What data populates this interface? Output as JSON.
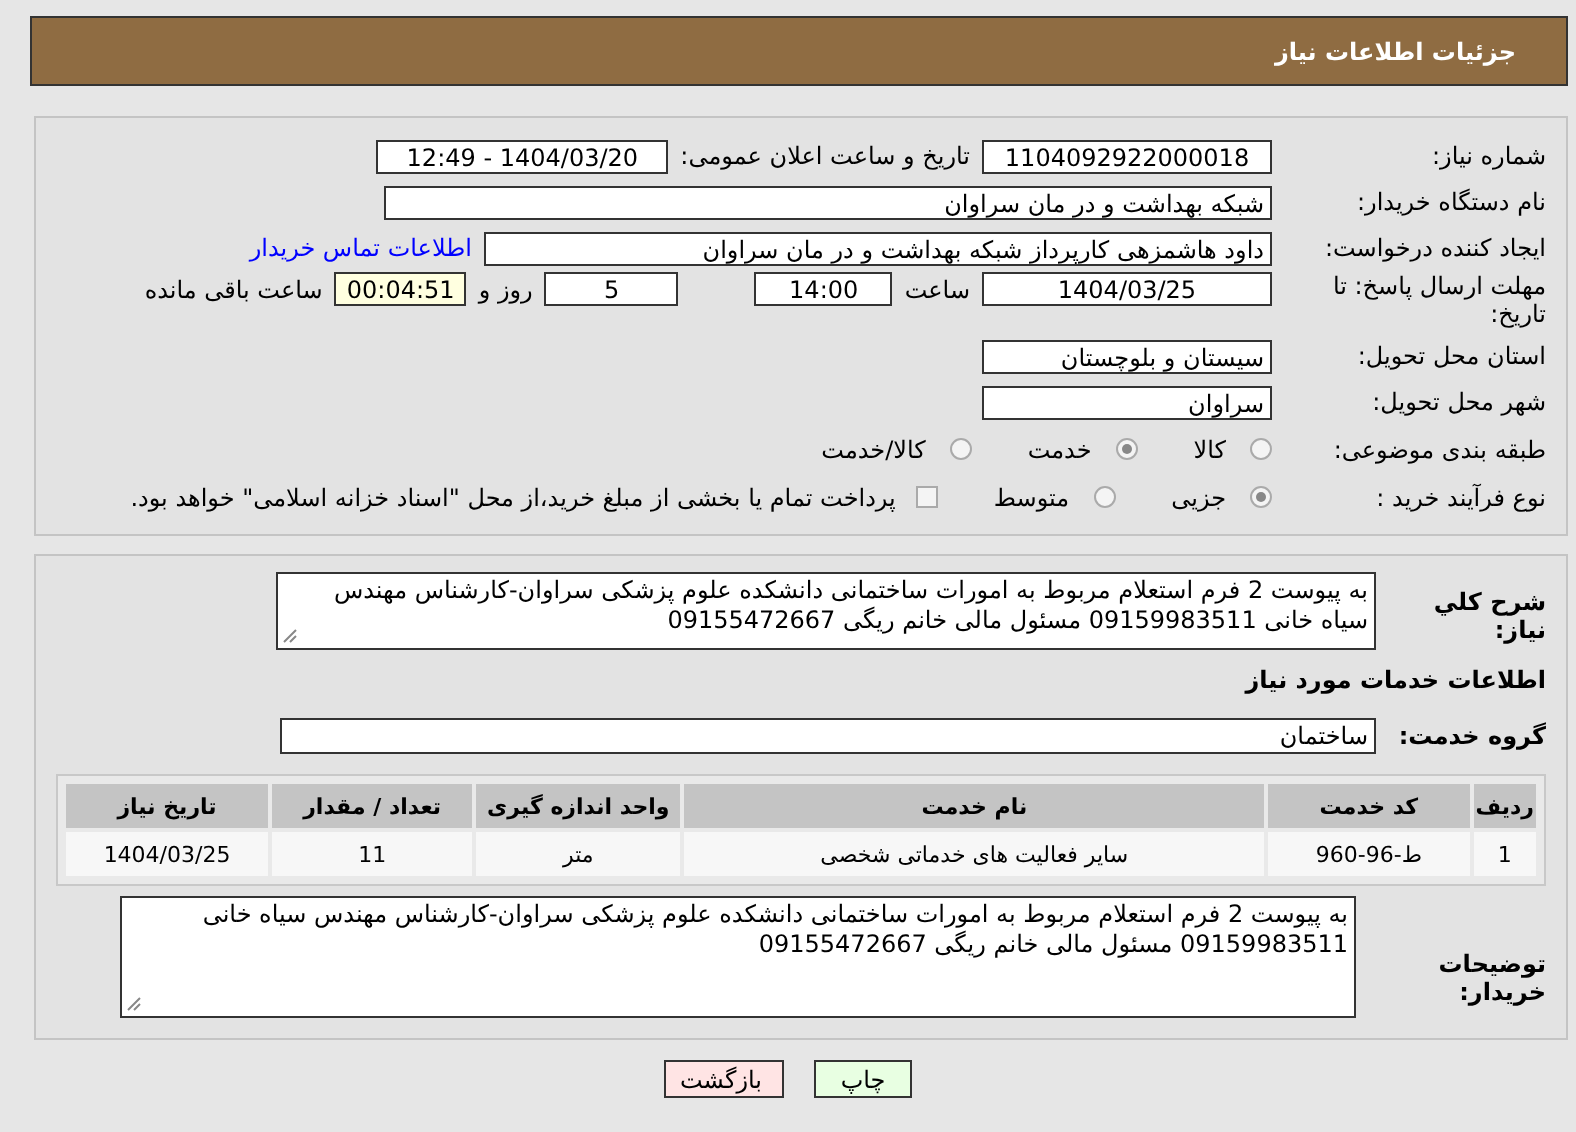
{
  "header": {
    "title": "جزئیات اطلاعات نیاز"
  },
  "need_number": {
    "label": "شماره نیاز:",
    "value": "1104092922000018"
  },
  "announce": {
    "label": "تاریخ و ساعت اعلان عمومی:",
    "value": "1404/03/20 - 12:49"
  },
  "buyer_org": {
    "label": "نام دستگاه خریدار:",
    "value": "شبکه بهداشت و در مان سراوان"
  },
  "requester": {
    "label": "ایجاد کننده درخواست:",
    "value": "داود هاشمزهی  کارپرداز شبکه بهداشت و در مان سراوان",
    "link": "اطلاعات تماس خریدار"
  },
  "deadline": {
    "label": "مهلت ارسال پاسخ: تا تاریخ:",
    "date": "1404/03/25",
    "time_label": "ساعت",
    "time": "14:00",
    "days": "5",
    "days_label": "روز و",
    "remaining": "00:04:51",
    "remaining_label": "ساعت باقی مانده"
  },
  "province": {
    "label": "استان محل تحویل:",
    "value": "سیستان و بلوچستان"
  },
  "city": {
    "label": "شهر محل تحویل:",
    "value": "سراوان"
  },
  "category": {
    "label": "طبقه بندی موضوعی:",
    "options": [
      {
        "label": "کالا",
        "selected": false
      },
      {
        "label": "خدمت",
        "selected": true
      },
      {
        "label": "کالا/خدمت",
        "selected": false
      }
    ]
  },
  "purchase_type": {
    "label": "نوع فرآیند خرید :",
    "options": [
      {
        "label": "جزیی",
        "selected": true
      },
      {
        "label": "متوسط",
        "selected": false
      }
    ],
    "payment_note": {
      "label": "پرداخت تمام یا بخشی از مبلغ خرید،از محل \"اسناد خزانه اسلامی\" خواهد بود.",
      "checked": false
    }
  },
  "description": {
    "label": "شرح کلي نياز:",
    "value": "به پیوست 2 فرم استعلام مربوط به امورات ساختمانی دانشکده علوم پزشکی سراوان-کارشناس مهندس سیاه خانی 09159983511  مسئول  مالی خانم ریگی 09155472667"
  },
  "services_title": "اطلاعات خدمات مورد نیاز",
  "service_group": {
    "label": "گروه خدمت:",
    "value": "ساختمان"
  },
  "table": {
    "columns": [
      "ردیف",
      "کد خدمت",
      "نام خدمت",
      "واحد اندازه گیری",
      "تعداد / مقدار",
      "تاریخ نیاز"
    ],
    "rows": [
      [
        "1",
        "ط-96-960",
        "سایر فعالیت های خدماتی شخصی",
        "متر",
        "11",
        "1404/03/25"
      ]
    ]
  },
  "buyer_notes": {
    "label": "توضیحات خریدار:",
    "value": "به پیوست 2 فرم استعلام مربوط به امورات ساختمانی دانشکده علوم پزشکی سراوان-کارشناس مهندس سیاه خانی 09159983511  مسئول  مالی خانم ریگی 09155472667"
  },
  "buttons": [
    {
      "label": "چاپ",
      "kind": "print"
    },
    {
      "label": "بازگشت",
      "kind": "back"
    }
  ]
}
